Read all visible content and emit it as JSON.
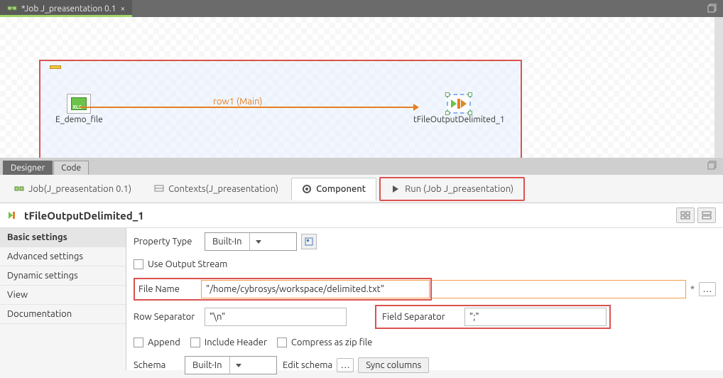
{
  "tab": {
    "title": "*Job J_preasentation 0.1"
  },
  "canvas": {
    "input_label": "E_demo_file",
    "output_label": "tFileOutputDelimited_1",
    "link_label": "row1 (Main)"
  },
  "sub_tabs": {
    "designer": "Designer",
    "code": "Code"
  },
  "lower_tabs": {
    "job": "Job(J_preasentation 0.1)",
    "contexts": "Contexts(J_preasentation)",
    "component": "Component",
    "run": "Run (Job J_preasentation)"
  },
  "panel_title": "tFileOutputDelimited_1",
  "nav": {
    "basic": "Basic settings",
    "advanced": "Advanced settings",
    "dynamic": "Dynamic settings",
    "view": "View",
    "doc": "Documentation"
  },
  "form": {
    "property_type_label": "Property Type",
    "property_type_value": "Built-In",
    "use_output_stream": "Use Output Stream",
    "file_name_label": "File Name",
    "file_name_value": "\"/home/cybrosys/workspace/delimited.txt\"",
    "row_sep_label": "Row Separator",
    "row_sep_value": "\"\\n\"",
    "field_sep_label": "Field Separator",
    "field_sep_value": "\";\"",
    "append": "Append",
    "include_header": "Include Header",
    "compress": "Compress as zip file",
    "schema_label": "Schema",
    "schema_value": "Built-In",
    "edit_schema": "Edit schema",
    "sync_columns": "Sync columns"
  }
}
